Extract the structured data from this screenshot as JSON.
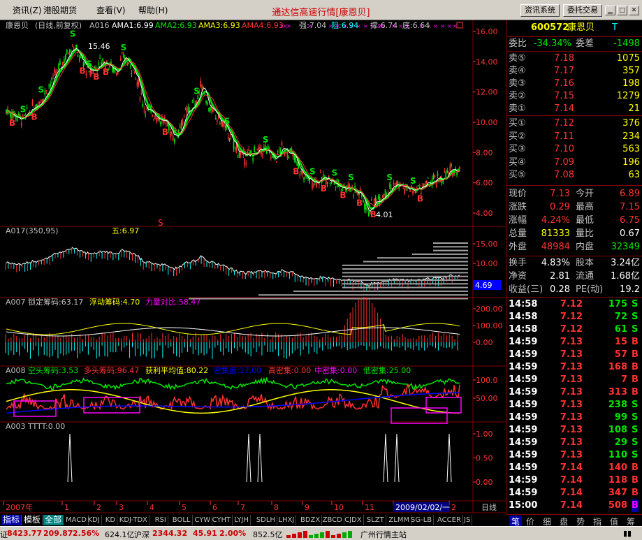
{
  "menubar": {
    "items": [
      "资讯(Z)",
      "港股期货",
      "查看(V)",
      "帮助(H)"
    ],
    "title": "通达信高速行情[康恩贝]",
    "btn1": "资讯系统",
    "btn2": "委托交易"
  },
  "colors": {
    "up": "#ff3232",
    "down": "#00e600",
    "yellow": "#ffff00",
    "cyan": "#00ffff",
    "magenta": "#ff00ff",
    "axis": "#800000",
    "white": "#ffffff",
    "gray": "#c0c0c0"
  },
  "main_header": {
    "name": "康恩贝",
    "mode": "(日线,前复权)",
    "ind": "A016",
    "ama1": "AMA1:6.99",
    "ama2": "AMA2:6.93",
    "ama3": "AMA3:6.93",
    "ama4": "AMA4:6.93",
    "qiang": "强:7.04",
    "zu": "阻:6.94",
    "cheng": "撑:6.74",
    "di": "底:6.64",
    "high_label": "15.46",
    "low_label": "4.01",
    "s_marker": "S",
    "b_marker": "B"
  },
  "panel2": {
    "header": "A017(350,95)",
    "wu": "五:6.97",
    "current": "4.69"
  },
  "panel3": {
    "header": "A007",
    "suoding": "锁定筹码:63.17",
    "fudong": "浮动筹码:4.70",
    "liliang": "力量对比:58.47"
  },
  "panel4": {
    "header": "A008",
    "kongtou": "空头筹码:3.53",
    "duotou": "多头筹码:96.47",
    "huoli": "获利平均值:80.22",
    "mijidu": "密集度:17.00",
    "gaomi": "高密集:0.00",
    "zhongmi": "中密集:0.00",
    "dimi": "低密集:25.00"
  },
  "panel5": {
    "header": "A003",
    "tttt": "TTTT:0.00"
  },
  "axes": {
    "main": [
      "16.00",
      "14.00",
      "12.00",
      "10.00",
      "8.00",
      "6.00",
      "4.00"
    ],
    "p2": [
      "15.00",
      "10.00",
      "5.00"
    ],
    "p3": [
      "200.00",
      "100.00",
      "0.00"
    ],
    "p4": [
      "100.0",
      "50.00"
    ],
    "p5": [
      "1.00",
      "0.50",
      "0.00"
    ]
  },
  "timeline": {
    "labels": [
      "2007年",
      "1",
      "2",
      "3",
      "4",
      "5",
      "6",
      "7",
      "8",
      "9",
      "10",
      "11",
      "12",
      "2"
    ],
    "cursor": "2009/02/02/一",
    "period": "日线"
  },
  "tabs": [
    "指标",
    "模板",
    "全部",
    "MACD",
    "KDJ",
    "KD",
    "KDJ-TDX",
    "RSI",
    "BOLL",
    "CYW",
    "CYHT",
    "LYJH",
    "SDLH",
    "LHXJ",
    "BDZX",
    "ZBCD",
    "CJDX",
    "SLZT",
    "ZLMM",
    "SG-LB",
    "ACCER",
    "JS"
  ],
  "quote": {
    "code": "600572",
    "name": "康恩贝",
    "t": "T",
    "weibi_label": "委比",
    "weibi": "-34.34%",
    "weicha_label": "委差",
    "weicha": "-1498",
    "asks": [
      {
        "label": "卖⑤",
        "price": "7.18",
        "vol": "1075"
      },
      {
        "label": "卖④",
        "price": "7.17",
        "vol": "357"
      },
      {
        "label": "卖③",
        "price": "7.16",
        "vol": "198"
      },
      {
        "label": "卖②",
        "price": "7.15",
        "vol": "1279"
      },
      {
        "label": "卖①",
        "price": "7.14",
        "vol": "21"
      }
    ],
    "bids": [
      {
        "label": "买①",
        "price": "7.12",
        "vol": "376"
      },
      {
        "label": "买②",
        "price": "7.11",
        "vol": "234"
      },
      {
        "label": "买③",
        "price": "7.10",
        "vol": "563"
      },
      {
        "label": "买④",
        "price": "7.09",
        "vol": "196"
      },
      {
        "label": "买⑤",
        "price": "7.08",
        "vol": "63"
      }
    ],
    "stats": [
      {
        "l1": "现价",
        "v1": "7.13",
        "l2": "今开",
        "v2": "6.89",
        "c1": "#ff3232",
        "c2": "#ff3232"
      },
      {
        "l1": "涨跌",
        "v1": "0.29",
        "l2": "最高",
        "v2": "7.15",
        "c1": "#ff3232",
        "c2": "#ff3232"
      },
      {
        "l1": "涨幅",
        "v1": "4.24%",
        "l2": "最低",
        "v2": "6.75",
        "c1": "#ff3232",
        "c2": "#ff3232"
      },
      {
        "l1": "总量",
        "v1": "81333",
        "l2": "量比",
        "v2": "0.67",
        "c1": "#ffff00",
        "c2": "#ffffff"
      },
      {
        "l1": "外盘",
        "v1": "48984",
        "l2": "内盘",
        "v2": "32349",
        "c1": "#ff3232",
        "c2": "#00e600"
      }
    ],
    "stats2": [
      {
        "l1": "换手",
        "v1": "4.83%",
        "l2": "股本",
        "v2": "3.24亿"
      },
      {
        "l1": "净资",
        "v1": "2.81",
        "l2": "流通",
        "v2": "1.68亿"
      },
      {
        "l1": "收益(三)",
        "v1": "0.28",
        "l2": "PE(动)",
        "v2": "19.2"
      }
    ],
    "ticks": [
      {
        "t": "14:58",
        "p": "7.12",
        "v": "175",
        "d": "S"
      },
      {
        "t": "14:58",
        "p": "7.12",
        "v": "72",
        "d": "S"
      },
      {
        "t": "14:58",
        "p": "7.12",
        "v": "61",
        "d": "S"
      },
      {
        "t": "14:59",
        "p": "7.13",
        "v": "15",
        "d": "B"
      },
      {
        "t": "14:59",
        "p": "7.13",
        "v": "57",
        "d": "B"
      },
      {
        "t": "14:59",
        "p": "7.13",
        "v": "168",
        "d": "B"
      },
      {
        "t": "14:59",
        "p": "7.13",
        "v": "7",
        "d": "B"
      },
      {
        "t": "14:59",
        "p": "7.13",
        "v": "313",
        "d": "B"
      },
      {
        "t": "14:59",
        "p": "7.13",
        "v": "238",
        "d": "S"
      },
      {
        "t": "14:59",
        "p": "7.13",
        "v": "99",
        "d": "S"
      },
      {
        "t": "14:59",
        "p": "7.13",
        "v": "108",
        "d": "S"
      },
      {
        "t": "14:59",
        "p": "7.13",
        "v": "29",
        "d": "S"
      },
      {
        "t": "14:59",
        "p": "7.13",
        "v": "110",
        "d": "S"
      },
      {
        "t": "14:59",
        "p": "7.14",
        "v": "140",
        "d": "B"
      },
      {
        "t": "14:59",
        "p": "7.14",
        "v": "118",
        "d": "B"
      },
      {
        "t": "14:59",
        "p": "7.14",
        "v": "347",
        "d": "B"
      },
      {
        "t": "15:00",
        "p": "7.14",
        "v": "508",
        "d": "B"
      }
    ],
    "tabs": [
      "笔",
      "价",
      "细",
      "盘",
      "势",
      "指",
      "值",
      "筹"
    ]
  },
  "status": {
    "sh_idx": "8423.77",
    "sh_chg": "209.87",
    "sh_pct": "2.56%",
    "sh_amt": "624.1亿",
    "sz_name": "沪深",
    "sz_idx": "2344.32",
    "sz_chg": "45.91",
    "sz_pct": "2.00%",
    "sz_amt": "852.5亿",
    "server": "广州行情主站",
    "prefix": "证"
  }
}
